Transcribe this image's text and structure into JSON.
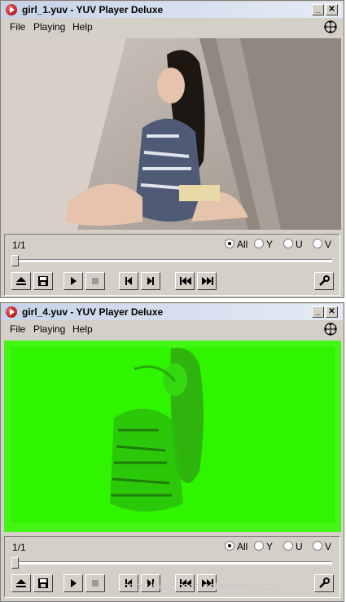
{
  "windows": [
    {
      "title": "girl_1.yuv - YUV Player Deluxe",
      "menu": [
        "File",
        "Playing",
        "Help"
      ],
      "frame_counter": "1/1",
      "channels": [
        {
          "label": "All",
          "selected": true
        },
        {
          "label": "Y",
          "selected": false
        },
        {
          "label": "U",
          "selected": false
        },
        {
          "label": "V",
          "selected": false
        }
      ],
      "video_tint": "#bdb5ac"
    },
    {
      "title": "girl_4.yuv - YUV Player Deluxe",
      "menu": [
        "File",
        "Playing",
        "Help"
      ],
      "frame_counter": "1/1",
      "channels": [
        {
          "label": "All",
          "selected": true
        },
        {
          "label": "Y",
          "selected": false
        },
        {
          "label": "U",
          "selected": false
        },
        {
          "label": "V",
          "selected": false
        }
      ],
      "video_tint": "#33ff00"
    }
  ],
  "colors": {
    "window_bg": "#d4d0c8",
    "titlebar": "#c6d3e8",
    "green_frame": "#33ff00"
  },
  "watermark": "https://blog.csdn.net/weixin_5117...",
  "icons": [
    "eject-icon",
    "save-icon",
    "play-icon",
    "stop-icon",
    "prev-frame-icon",
    "next-frame-icon",
    "first-frame-icon",
    "last-frame-icon",
    "settings-wrench-icon",
    "move-icon"
  ]
}
